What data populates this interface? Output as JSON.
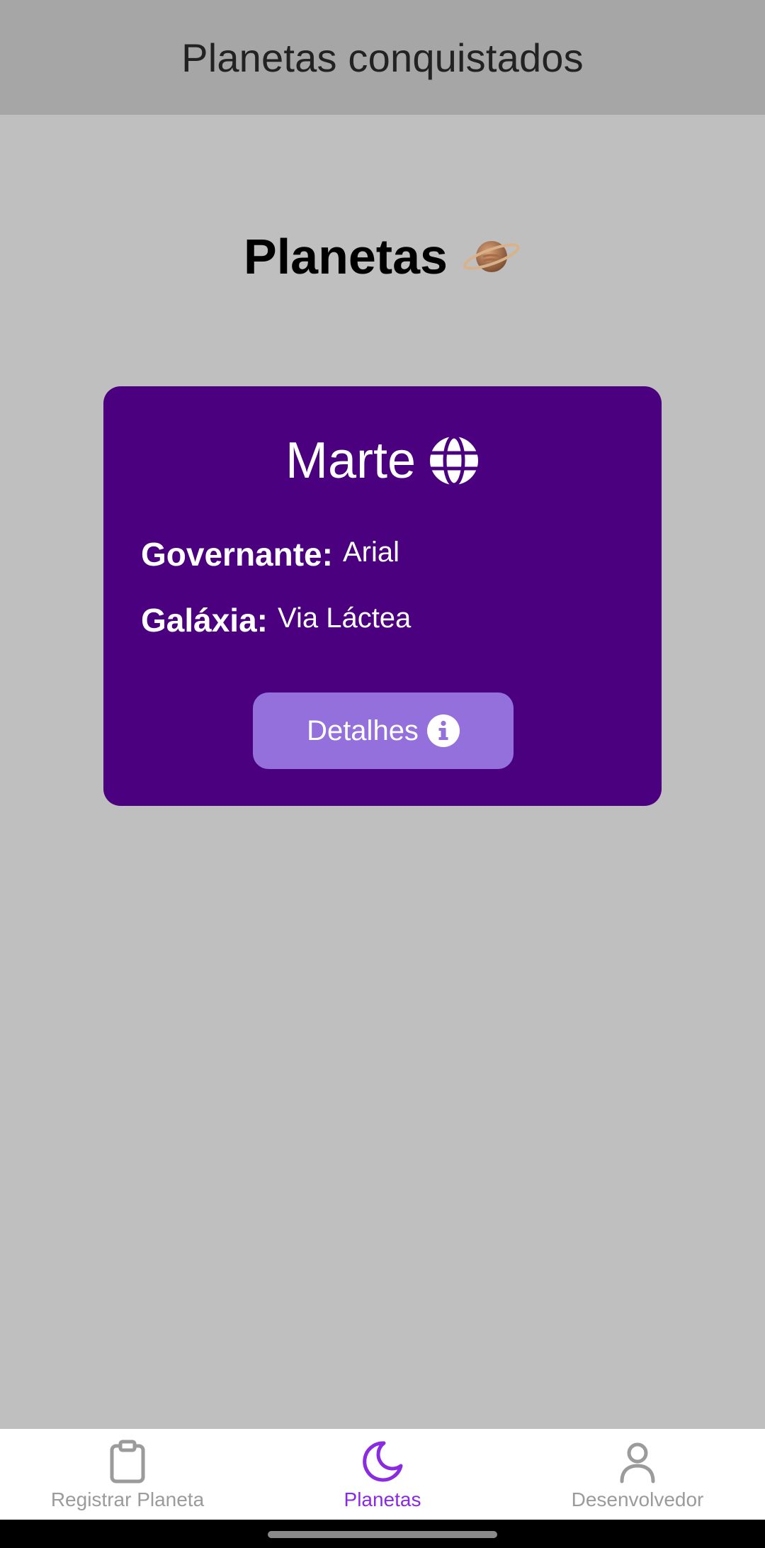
{
  "header": {
    "title": "Planetas conquistados"
  },
  "main": {
    "heading": "Planetas",
    "heading_icon": "ringed-planet-emoji"
  },
  "card": {
    "title": "Marte",
    "title_icon": "globe-icon",
    "governor_label": "Governante:",
    "governor_value": "Arial",
    "galaxy_label": "Galáxia:",
    "galaxy_value": "Via Láctea",
    "details_button_label": "Detalhes",
    "details_icon": "info-icon",
    "background_color": "#4b007f",
    "button_color": "#9370db"
  },
  "bottom_nav": {
    "items": [
      {
        "label": "Registrar Planeta",
        "icon": "clipboard-icon",
        "active": false
      },
      {
        "label": "Planetas",
        "icon": "moon-icon",
        "active": true
      },
      {
        "label": "Desenvolvedor",
        "icon": "user-icon",
        "active": false
      }
    ],
    "active_color": "#8a2be2",
    "inactive_color": "#9b9b9b"
  }
}
